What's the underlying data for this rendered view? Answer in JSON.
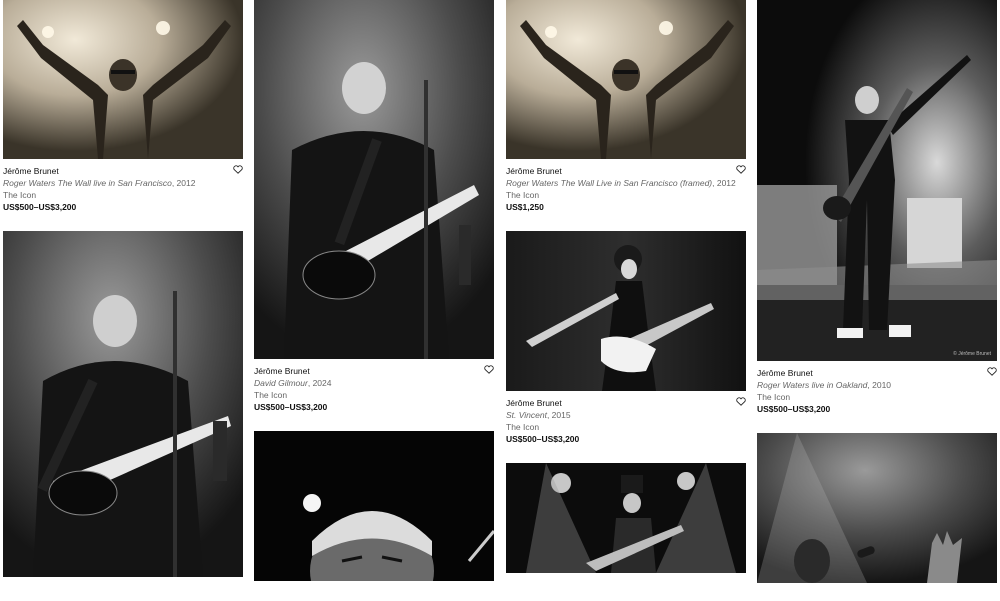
{
  "artworks": [
    {
      "artist": "Jérôme Brunet",
      "title": "Roger Waters The Wall live in San Francisco",
      "year": ", 2012",
      "gallery": "The Icon",
      "price": "US$500–US$3,200",
      "image": "roger-waters-arms-raised-sepia"
    },
    {
      "artist": "Jérôme Brunet",
      "title": "David Gilmour",
      "year": ", 2024",
      "gallery": "The Icon",
      "price": "US$500–US$3,200",
      "image": "david-gilmour-guitar-bw"
    },
    {
      "artist": "Jérôme Brunet",
      "title": "Roger Waters The Wall Live in San Francisco (framed)",
      "year": ", 2012",
      "gallery": "The Icon",
      "price": "US$1,250",
      "image": "roger-waters-arms-raised-sepia"
    },
    {
      "artist": "Jérôme Brunet",
      "title": "Roger Waters live in Oakland",
      "year": ", 2010",
      "gallery": "The Icon",
      "price": "US$500–US$3,200",
      "image": "roger-waters-pointing-stage",
      "credit": "© Jérôme Brunet"
    },
    {
      "artist": "",
      "title": "",
      "year": "",
      "gallery": "",
      "price": "",
      "image": "david-gilmour-guitar-bw"
    },
    {
      "artist": "Jérôme Brunet",
      "title": "St. Vincent",
      "year": ", 2015",
      "gallery": "The Icon",
      "price": "US$500–US$3,200",
      "image": "st-vincent-white-guitar"
    },
    {
      "image": "old-man-closeup-face"
    },
    {
      "image": "guitarist-top-hat-stage-lights"
    },
    {
      "image": "singer-microphone-hands-raised"
    }
  ],
  "icons": {
    "favorite": "heart-outline-icon"
  },
  "colors": {
    "text": "#111111",
    "secondary": "#666666",
    "background": "#ffffff"
  }
}
